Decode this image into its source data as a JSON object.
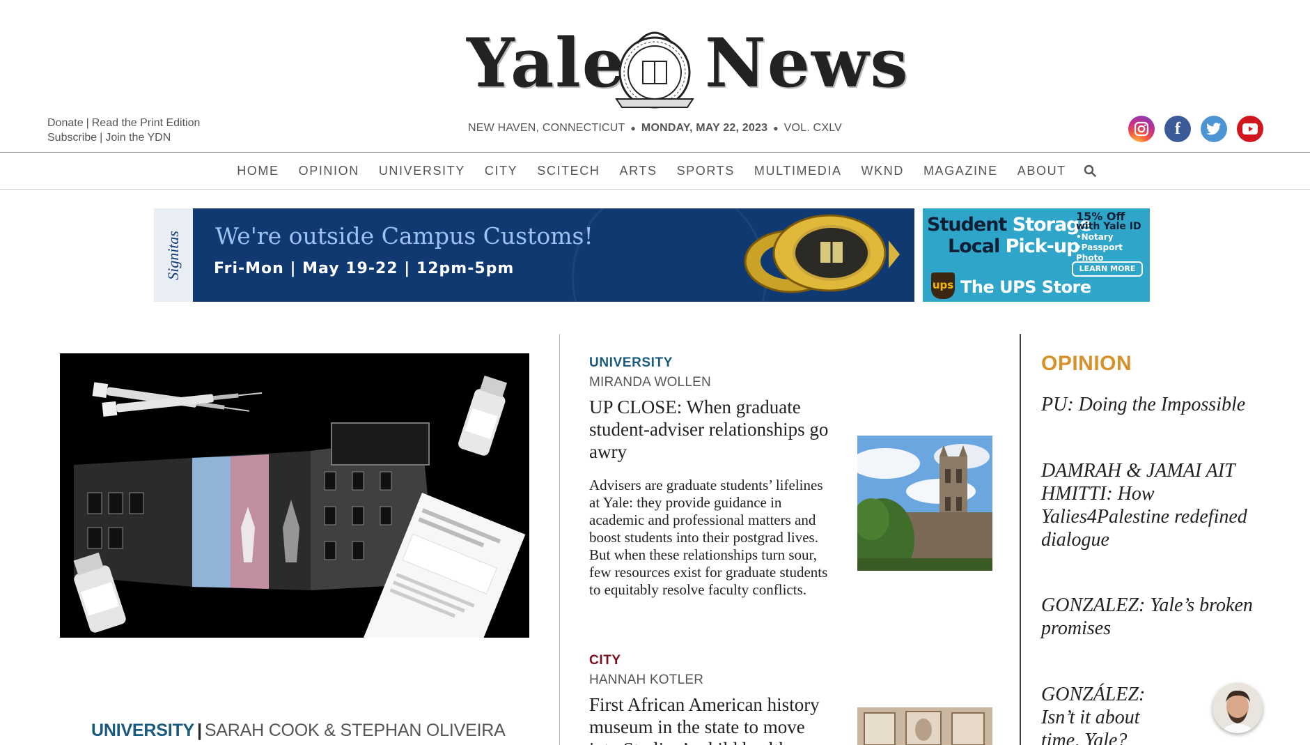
{
  "masthead": {
    "logo_left": "Yale",
    "logo_right": "News",
    "links_row1": [
      "Donate",
      "Read the Print Edition"
    ],
    "links_row2": [
      "Subscribe",
      "Join the YDN"
    ],
    "location": "NEW HAVEN, CONNECTICUT",
    "date": "MONDAY, MAY 22, 2023",
    "volume": "VOL. CXLV",
    "socials": [
      {
        "name": "instagram",
        "icon": "instagram-icon",
        "color": "#c22e8c"
      },
      {
        "name": "facebook",
        "icon": "facebook-icon",
        "color": "#3b5b98"
      },
      {
        "name": "twitter",
        "icon": "twitter-icon",
        "color": "#4c95d4"
      },
      {
        "name": "youtube",
        "icon": "youtube-icon",
        "color": "#d2161e"
      }
    ]
  },
  "nav": {
    "items": [
      "HOME",
      "OPINION",
      "UNIVERSITY",
      "CITY",
      "SCITECH",
      "ARTS",
      "SPORTS",
      "MULTIMEDIA",
      "WKND",
      "MAGAZINE",
      "ABOUT"
    ],
    "search_icon": "search-icon"
  },
  "ads": {
    "main": {
      "brand": "Signitas",
      "headline": "We're outside Campus Customs!",
      "details": "Fri-Mon | May 19-22 | 12pm-5pm"
    },
    "side": {
      "line1a": "Student",
      "line1b": "Storage",
      "line2a": "Local",
      "line2b": "Pick-up",
      "offer": "15% Off",
      "offer_sub": "with Yale ID",
      "bullets": [
        "•Notary",
        "•Passport Photo"
      ],
      "cta": "LEARN MORE",
      "logo": "ups",
      "store": "The UPS Store"
    }
  },
  "hero": {
    "kicker": "UNIVERSITY",
    "separator": "|",
    "authors": "SARAH COOK & STEPHAN OLIVEIRA"
  },
  "stories": [
    {
      "kicker": "UNIVERSITY",
      "byline": "MIRANDA WOLLEN",
      "headline": "UP CLOSE: When graduate student-adviser relationships go awry",
      "dek": "Advisers are graduate students’ lifelines at Yale: they provide guidance in academic and professional matters and boost students into their postgrad lives. But when these relationships turn sour, few resources exist for graduate students to equitably resolve faculty conflicts."
    },
    {
      "kicker": "CITY",
      "byline": "HANNAH KOTLER",
      "headline": "First African American history museum in the state to move into Starling’s child health"
    }
  ],
  "opinion": {
    "title": "OPINION",
    "items": [
      "PU: Doing the Impossible",
      "DAMRAH & JAMAI AIT HMITTI: How Yalies4Palestine redefined dialogue",
      "GONZALEZ: Yale’s broken promises",
      "GONZÁLEZ: Isn’t it about time, Yale?"
    ]
  },
  "colors": {
    "university": "#1a5a7d",
    "city": "#7b0f1f",
    "opinion": "#d8902a"
  }
}
